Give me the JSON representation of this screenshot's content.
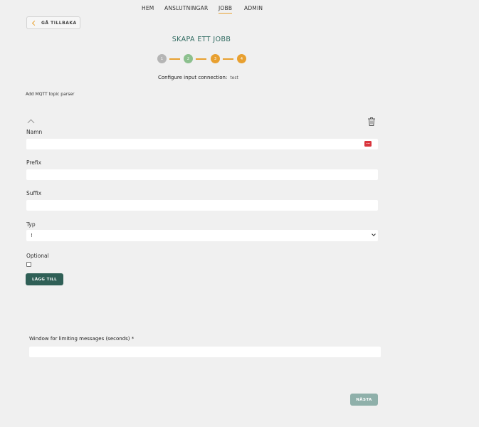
{
  "nav": {
    "items": [
      {
        "label": "HEM",
        "active": false
      },
      {
        "label": "ANSLUTNINGAR",
        "active": false
      },
      {
        "label": "JOBB",
        "active": true
      },
      {
        "label": "ADMIN",
        "active": false
      }
    ],
    "active_underline_color": "#e8a030"
  },
  "back_button": {
    "label": "GÅ TILLBAKA",
    "icon": "chevron-left-icon"
  },
  "page_title": "SKAPA ETT JOBB",
  "stepper": {
    "steps": [
      {
        "label": "1",
        "color": "#b5b5b5"
      },
      {
        "label": "2",
        "color": "#8cc08e"
      },
      {
        "label": "3",
        "color": "#e8a030"
      },
      {
        "label": "4",
        "color": "#e8a030"
      }
    ],
    "line_color": "#e8a030"
  },
  "configure": {
    "label": "Configure input connection:",
    "value": "test"
  },
  "parser": {
    "title": "Add MQTT topic parser",
    "collapse_icon": "chevron-up-icon",
    "delete_icon": "trash-icon",
    "fields": {
      "namn": {
        "label": "Namn",
        "value": "",
        "badge": "•••"
      },
      "prefix": {
        "label": "Prefix",
        "value": ""
      },
      "suffix": {
        "label": "Suffix",
        "value": ""
      },
      "typ": {
        "label": "Typ",
        "selected": "!"
      },
      "optional": {
        "label": "Optional",
        "checked": false
      }
    },
    "add_button": "LÄGG TILL"
  },
  "window": {
    "label": "Window for limiting messages (seconds) *",
    "value": ""
  },
  "next_button": "NÄSTA",
  "colors": {
    "brand_dark": "#2f5f56",
    "brand_disabled": "#8fb0aa",
    "accent": "#e8a030",
    "title": "#2f6a60"
  }
}
